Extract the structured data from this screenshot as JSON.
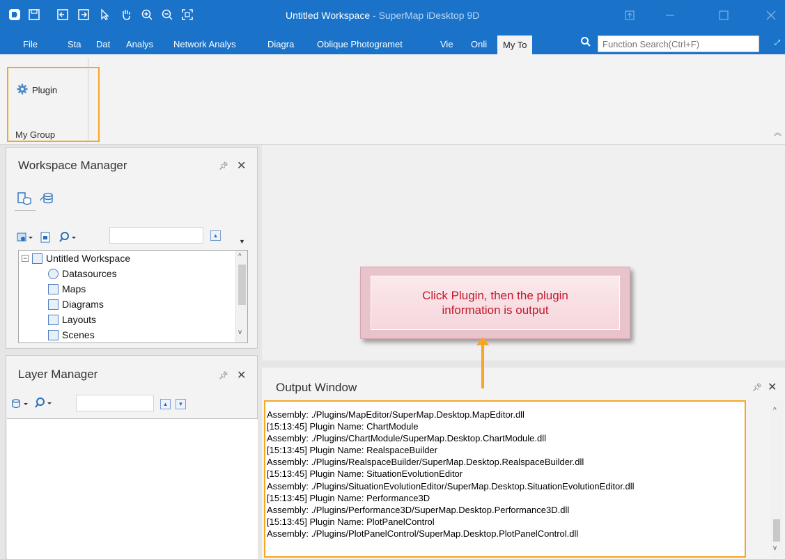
{
  "window": {
    "title_doc": "Untitled Workspace",
    "title_app": " - SuperMap iDesktop 9D"
  },
  "ribbon": {
    "tabs": [
      "File",
      "Sta",
      "Dat",
      "Analys",
      "Network Analys",
      "Diagra",
      "Oblique Photogramet",
      "Vie",
      "Onli",
      "My To"
    ],
    "active_tab_index": 9,
    "search_placeholder": "Function Search(Ctrl+F)",
    "group": {
      "button_label": "Plugin",
      "group_label": "My Group"
    }
  },
  "workspace_manager": {
    "title": "Workspace Manager",
    "tree": [
      {
        "label": "Untitled Workspace",
        "level": 0
      },
      {
        "label": "Datasources",
        "level": 1
      },
      {
        "label": "Maps",
        "level": 1
      },
      {
        "label": "Diagrams",
        "level": 1
      },
      {
        "label": "Layouts",
        "level": 1
      },
      {
        "label": "Scenes",
        "level": 1
      }
    ]
  },
  "layer_manager": {
    "title": "Layer Manager"
  },
  "output_window": {
    "title": "Output Window",
    "lines": [
      "Assembly: ./Plugins/MapEditor/SuperMap.Desktop.MapEditor.dll",
      "[15:13:45] Plugin Name: ChartModule",
      "Assembly: ./Plugins/ChartModule/SuperMap.Desktop.ChartModule.dll",
      "[15:13:45] Plugin Name: RealspaceBuilder",
      "Assembly: ./Plugins/RealspaceBuilder/SuperMap.Desktop.RealspaceBuilder.dll",
      "[15:13:45] Plugin Name: SituationEvolutionEditor",
      "Assembly: ./Plugins/SituationEvolutionEditor/SuperMap.Desktop.SituationEvolutionEditor.dll",
      "[15:13:45] Plugin Name: Performance3D",
      "Assembly: ./Plugins/Performance3D/SuperMap.Desktop.Performance3D.dll",
      "[15:13:45] Plugin Name: PlotPanelControl",
      "Assembly: ./Plugins/PlotPanelControl/SuperMap.Desktop.PlotPanelControl.dll"
    ]
  },
  "callout": {
    "text": "Click Plugin, then the plugin information is output"
  },
  "colors": {
    "title_bar": "#1a73c9",
    "highlight": "#f5a623",
    "callout_text": "#c4172b"
  },
  "icons": [
    "app-logo-icon",
    "save-icon",
    "open-icon",
    "export-icon",
    "select-arrow-icon",
    "pan-hand-icon",
    "zoom-in-icon",
    "zoom-out-icon",
    "full-extent-icon",
    "restore-icon",
    "minimize-icon",
    "maximize-icon",
    "close-icon",
    "search-icon",
    "gear-icon",
    "pin-icon"
  ]
}
